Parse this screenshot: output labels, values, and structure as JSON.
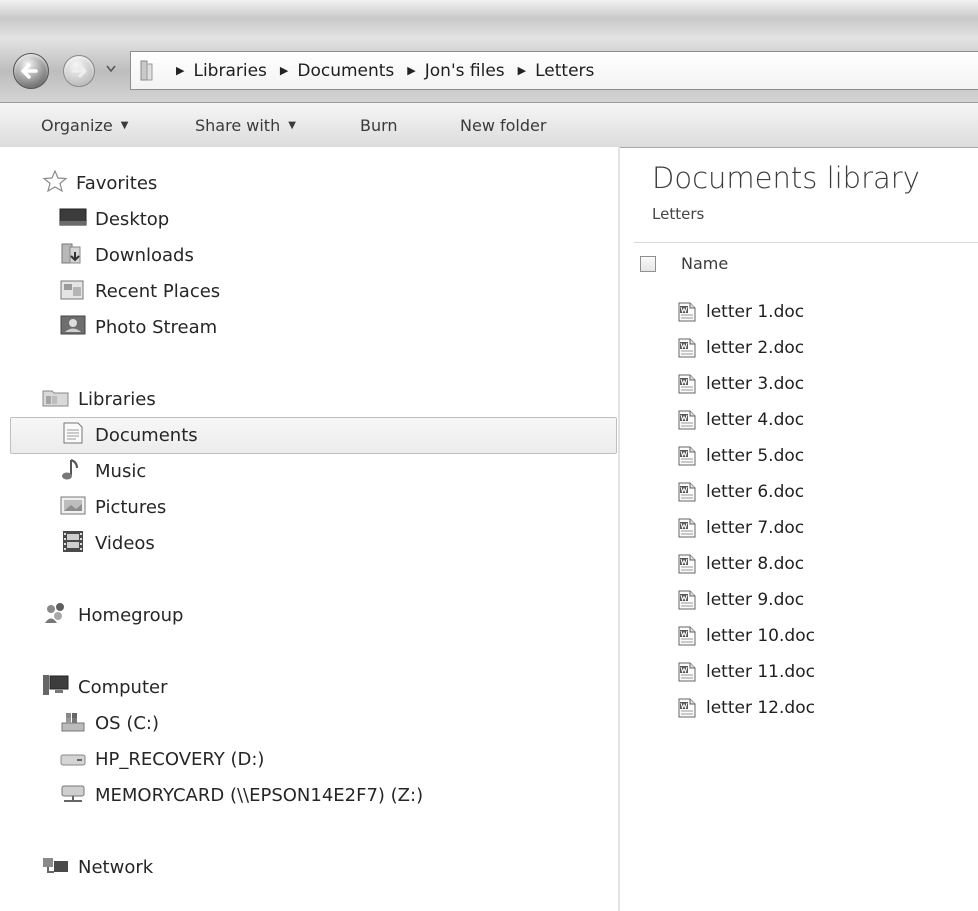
{
  "address_bar": {
    "crumbs": [
      "Libraries",
      "Documents",
      "Jon's files",
      "Letters"
    ]
  },
  "toolbar": {
    "organize": "Organize",
    "share_with": "Share with",
    "burn": "Burn",
    "new_folder": "New folder"
  },
  "nav_pane": {
    "favorites": {
      "label": "Favorites",
      "items": [
        "Desktop",
        "Downloads",
        "Recent Places",
        "Photo Stream"
      ]
    },
    "libraries": {
      "label": "Libraries",
      "items": [
        "Documents",
        "Music",
        "Pictures",
        "Videos"
      ],
      "selected": "Documents"
    },
    "homegroup": "Homegroup",
    "computer": {
      "label": "Computer",
      "items": [
        "OS (C:)",
        "HP_RECOVERY (D:)",
        "MEMORYCARD (\\\\EPSON14E2F7) (Z:)"
      ]
    },
    "network": "Network"
  },
  "content": {
    "title": "Documents library",
    "subtitle": "Letters",
    "column_name": "Name",
    "files": [
      "letter 1.doc",
      "letter 2.doc",
      "letter 3.doc",
      "letter 4.doc",
      "letter 5.doc",
      "letter 6.doc",
      "letter 7.doc",
      "letter 8.doc",
      "letter 9.doc",
      "letter 10.doc",
      "letter 11.doc",
      "letter 12.doc"
    ]
  }
}
